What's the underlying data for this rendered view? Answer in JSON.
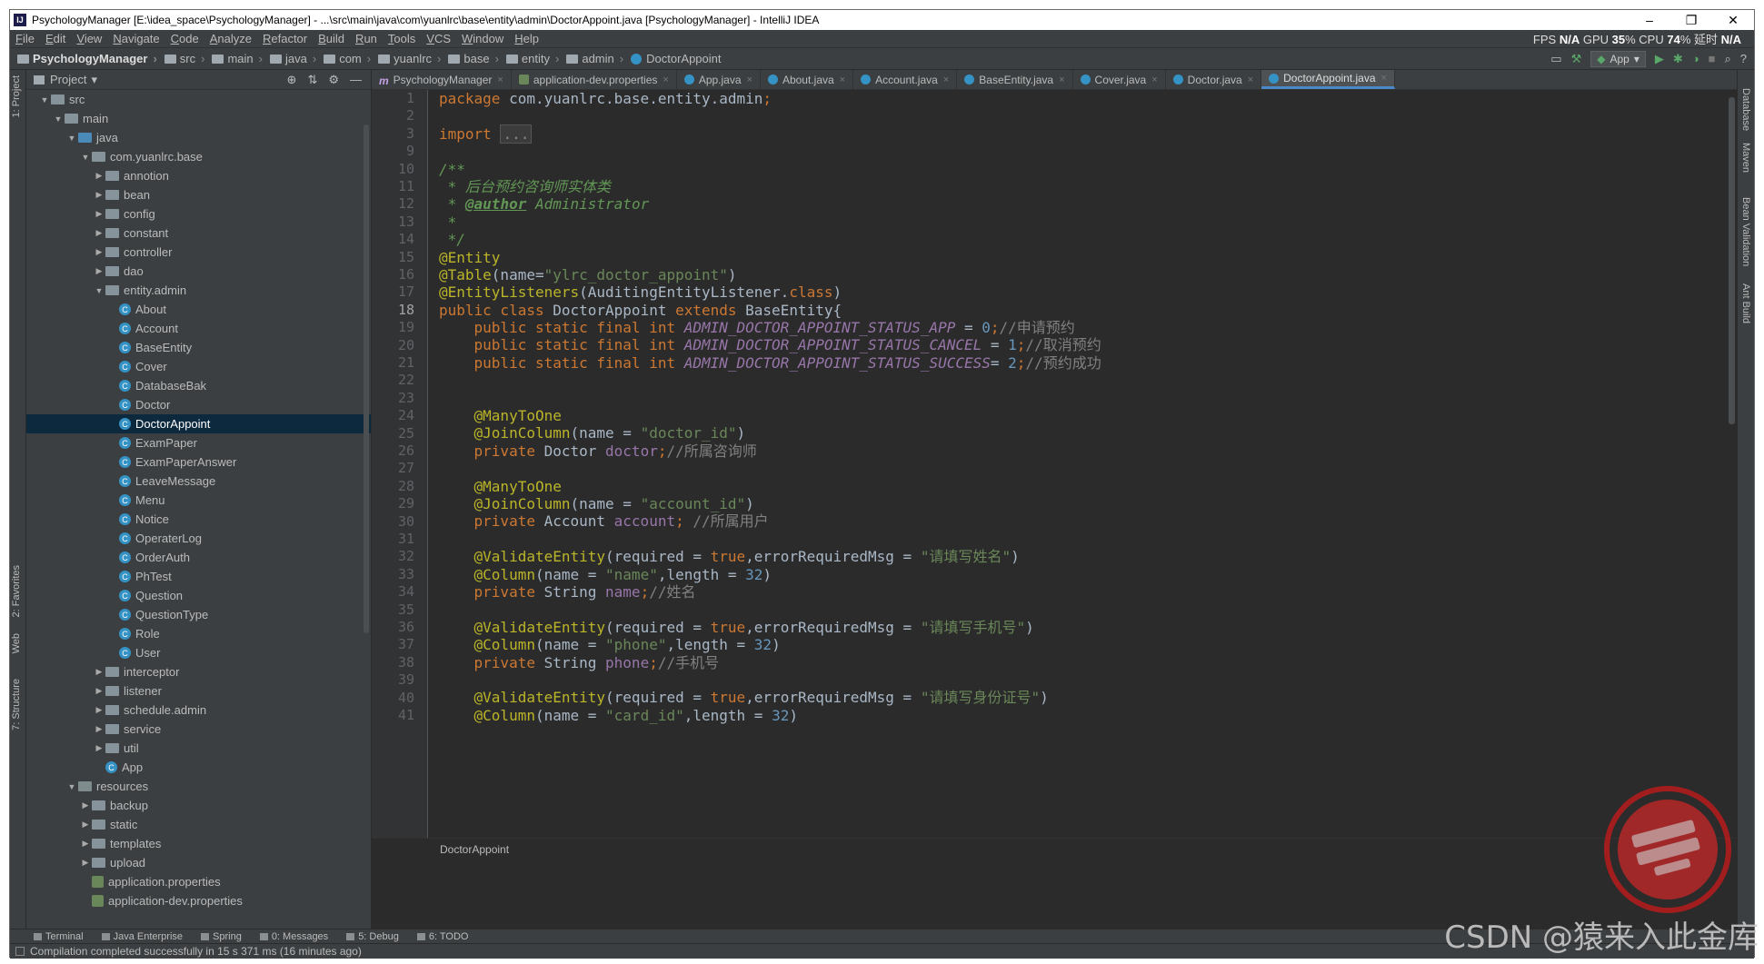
{
  "window": {
    "title": "PsychologyManager [E:\\idea_space\\PsychologyManager] - ...\\src\\main\\java\\com\\yuanlrc\\base\\entity\\admin\\DoctorAppoint.java [PsychologyManager] - IntelliJ IDEA",
    "app_icon": "IJ",
    "min": "–",
    "max": "❐",
    "close": "✕"
  },
  "menu": [
    "File",
    "Edit",
    "View",
    "Navigate",
    "Code",
    "Analyze",
    "Refactor",
    "Build",
    "Run",
    "Tools",
    "VCS",
    "Window",
    "Help"
  ],
  "perf": {
    "fps_label": "FPS",
    "fps": "N/A",
    "gpu_label": "GPU",
    "gpu": "35",
    "cpu_label": "% CPU",
    "cpu": "74",
    "delay_label": "% 延时",
    "delay": "N/A"
  },
  "breadcrumbs": [
    "PsychologyManager",
    "src",
    "main",
    "java",
    "com",
    "yuanlrc",
    "base",
    "entity",
    "admin",
    "DoctorAppoint"
  ],
  "run_config": "App",
  "project_panel": {
    "title": "Project",
    "tree": [
      {
        "label": "src",
        "depth": 1,
        "kind": "folder",
        "open": true
      },
      {
        "label": "main",
        "depth": 2,
        "kind": "folder",
        "open": true
      },
      {
        "label": "java",
        "depth": 3,
        "kind": "src",
        "open": true
      },
      {
        "label": "com.yuanlrc.base",
        "depth": 4,
        "kind": "folder",
        "open": true
      },
      {
        "label": "annotion",
        "depth": 5,
        "kind": "folder",
        "open": false
      },
      {
        "label": "bean",
        "depth": 5,
        "kind": "folder",
        "open": false
      },
      {
        "label": "config",
        "depth": 5,
        "kind": "folder",
        "open": false
      },
      {
        "label": "constant",
        "depth": 5,
        "kind": "folder",
        "open": false
      },
      {
        "label": "controller",
        "depth": 5,
        "kind": "folder",
        "open": false
      },
      {
        "label": "dao",
        "depth": 5,
        "kind": "folder",
        "open": false
      },
      {
        "label": "entity.admin",
        "depth": 5,
        "kind": "folder",
        "open": true
      },
      {
        "label": "About",
        "depth": 6,
        "kind": "class"
      },
      {
        "label": "Account",
        "depth": 6,
        "kind": "class"
      },
      {
        "label": "BaseEntity",
        "depth": 6,
        "kind": "class"
      },
      {
        "label": "Cover",
        "depth": 6,
        "kind": "class"
      },
      {
        "label": "DatabaseBak",
        "depth": 6,
        "kind": "class"
      },
      {
        "label": "Doctor",
        "depth": 6,
        "kind": "class"
      },
      {
        "label": "DoctorAppoint",
        "depth": 6,
        "kind": "class",
        "selected": true
      },
      {
        "label": "ExamPaper",
        "depth": 6,
        "kind": "class"
      },
      {
        "label": "ExamPaperAnswer",
        "depth": 6,
        "kind": "class"
      },
      {
        "label": "LeaveMessage",
        "depth": 6,
        "kind": "class"
      },
      {
        "label": "Menu",
        "depth": 6,
        "kind": "class"
      },
      {
        "label": "Notice",
        "depth": 6,
        "kind": "class"
      },
      {
        "label": "OperaterLog",
        "depth": 6,
        "kind": "class"
      },
      {
        "label": "OrderAuth",
        "depth": 6,
        "kind": "class"
      },
      {
        "label": "PhTest",
        "depth": 6,
        "kind": "class"
      },
      {
        "label": "Question",
        "depth": 6,
        "kind": "class"
      },
      {
        "label": "QuestionType",
        "depth": 6,
        "kind": "class"
      },
      {
        "label": "Role",
        "depth": 6,
        "kind": "class"
      },
      {
        "label": "User",
        "depth": 6,
        "kind": "class"
      },
      {
        "label": "interceptor",
        "depth": 5,
        "kind": "folder",
        "open": false
      },
      {
        "label": "listener",
        "depth": 5,
        "kind": "folder",
        "open": false
      },
      {
        "label": "schedule.admin",
        "depth": 5,
        "kind": "folder",
        "open": false
      },
      {
        "label": "service",
        "depth": 5,
        "kind": "folder",
        "open": false
      },
      {
        "label": "util",
        "depth": 5,
        "kind": "folder",
        "open": false
      },
      {
        "label": "App",
        "depth": 5,
        "kind": "class"
      },
      {
        "label": "resources",
        "depth": 3,
        "kind": "res",
        "open": true
      },
      {
        "label": "backup",
        "depth": 4,
        "kind": "folder",
        "open": false
      },
      {
        "label": "static",
        "depth": 4,
        "kind": "folder",
        "open": false
      },
      {
        "label": "templates",
        "depth": 4,
        "kind": "folder",
        "open": false
      },
      {
        "label": "upload",
        "depth": 4,
        "kind": "folder",
        "open": false
      },
      {
        "label": "application.properties",
        "depth": 4,
        "kind": "prop"
      },
      {
        "label": "application-dev.properties",
        "depth": 4,
        "kind": "prop"
      }
    ]
  },
  "tabs": [
    {
      "label": "PsychologyManager",
      "icon": "m"
    },
    {
      "label": "application-dev.properties",
      "icon": "p"
    },
    {
      "label": "App.java",
      "icon": "c"
    },
    {
      "label": "About.java",
      "icon": "c"
    },
    {
      "label": "Account.java",
      "icon": "c"
    },
    {
      "label": "BaseEntity.java",
      "icon": "c"
    },
    {
      "label": "Cover.java",
      "icon": "c"
    },
    {
      "label": "Doctor.java",
      "icon": "c"
    },
    {
      "label": "DoctorAppoint.java",
      "icon": "c",
      "active": true
    }
  ],
  "code": {
    "current_line": 18,
    "lines": [
      {
        "n": 1,
        "html": "<span class=\"kw\">package </span>com.yuanlrc.base.entity.admin<span class=\"kw\">;</span>"
      },
      {
        "n": 2,
        "html": ""
      },
      {
        "n": 3,
        "html": "<span class=\"kw\">import </span><span class=\"fold-box\">...</span>"
      },
      {
        "n": 9,
        "html": ""
      },
      {
        "n": 10,
        "html": "<span class=\"doc\">/**</span>"
      },
      {
        "n": 11,
        "html": "<span class=\"doc\"> * 后台预约咨询师实体类</span>"
      },
      {
        "n": 12,
        "html": "<span class=\"doc\"> * </span><span class=\"doctag\">@author</span><span class=\"doc\"> Administrator</span>"
      },
      {
        "n": 13,
        "html": "<span class=\"doc\"> *</span>"
      },
      {
        "n": 14,
        "html": "<span class=\"doc\"> */</span>"
      },
      {
        "n": 15,
        "html": "<span class=\"ann\">@Entity</span>"
      },
      {
        "n": 16,
        "html": "<span class=\"ann\">@Table</span>(name=<span class=\"str\">\"ylrc_doctor_appoint\"</span>)"
      },
      {
        "n": 17,
        "html": "<span class=\"ann\">@EntityListeners</span>(AuditingEntityListener.<span class=\"kw\">class</span>)"
      },
      {
        "n": 18,
        "html": "<span class=\"kw\">public class </span>DoctorAppoint <span class=\"kw\">extends </span>BaseEntity{"
      },
      {
        "n": 19,
        "html": "    <span class=\"kw\">public static final int </span><span class=\"sfld\">ADMIN_DOCTOR_APPOINT_STATUS_APP</span> = <span class=\"num\">0</span><span class=\"kw\">;</span><span class=\"cmt\">//申请预约</span>"
      },
      {
        "n": 20,
        "html": "    <span class=\"kw\">public static final int </span><span class=\"sfld\">ADMIN_DOCTOR_APPOINT_STATUS_CANCEL</span> = <span class=\"num\">1</span><span class=\"kw\">;</span><span class=\"cmt\">//取消预约</span>"
      },
      {
        "n": 21,
        "html": "    <span class=\"kw\">public static final int </span><span class=\"sfld\">ADMIN_DOCTOR_APPOINT_STATUS_SUCCESS</span>= <span class=\"num\">2</span><span class=\"kw\">;</span><span class=\"cmt\">//预约成功</span>"
      },
      {
        "n": 22,
        "html": ""
      },
      {
        "n": 23,
        "html": ""
      },
      {
        "n": 24,
        "html": "    <span class=\"ann\">@ManyToOne</span>"
      },
      {
        "n": 25,
        "html": "    <span class=\"ann\">@JoinColumn</span>(name = <span class=\"str\">\"doctor_id\"</span>)"
      },
      {
        "n": 26,
        "html": "    <span class=\"kw\">private </span>Doctor <span class=\"fld\">doctor</span><span class=\"kw\">;</span><span class=\"cmt\">//所属咨询师</span>"
      },
      {
        "n": 27,
        "html": ""
      },
      {
        "n": 28,
        "html": "    <span class=\"ann\">@ManyToOne</span>"
      },
      {
        "n": 29,
        "html": "    <span class=\"ann\">@JoinColumn</span>(name = <span class=\"str\">\"account_id\"</span>)"
      },
      {
        "n": 30,
        "html": "    <span class=\"kw\">private </span>Account <span class=\"fld\">account</span><span class=\"kw\">; </span><span class=\"cmt\">//所属用户</span>"
      },
      {
        "n": 31,
        "html": ""
      },
      {
        "n": 32,
        "html": "    <span class=\"ann\">@ValidateEntity</span>(required = <span class=\"kw\">true</span>,errorRequiredMsg = <span class=\"str\">\"请填写姓名\"</span>)"
      },
      {
        "n": 33,
        "html": "    <span class=\"ann\">@Column</span>(name = <span class=\"str\">\"name\"</span>,length = <span class=\"num\">32</span>)"
      },
      {
        "n": 34,
        "html": "    <span class=\"kw\">private </span>String <span class=\"fld\">name</span><span class=\"kw\">;</span><span class=\"cmt\">//姓名</span>"
      },
      {
        "n": 35,
        "html": ""
      },
      {
        "n": 36,
        "html": "    <span class=\"ann\">@ValidateEntity</span>(required = <span class=\"kw\">true</span>,errorRequiredMsg = <span class=\"str\">\"请填写手机号\"</span>)"
      },
      {
        "n": 37,
        "html": "    <span class=\"ann\">@Column</span>(name = <span class=\"str\">\"phone\"</span>,length = <span class=\"num\">32</span>)"
      },
      {
        "n": 38,
        "html": "    <span class=\"kw\">private </span>String <span class=\"fld\">phone</span><span class=\"kw\">;</span><span class=\"cmt\">//手机号</span>"
      },
      {
        "n": 39,
        "html": ""
      },
      {
        "n": 40,
        "html": "    <span class=\"ann\">@ValidateEntity</span>(required = <span class=\"kw\">true</span>,errorRequiredMsg = <span class=\"str\">\"请填写身份证号\"</span>)"
      },
      {
        "n": 41,
        "html": "    <span class=\"ann\">@Column</span>(name = <span class=\"str\">\"card_id\"</span>,length = <span class=\"num\">32</span>)"
      }
    ]
  },
  "editor_breadcrumb": "DoctorAppoint",
  "right_stripe": [
    "Database",
    "Maven",
    "Bean Validation",
    "Ant Build"
  ],
  "left_stripe": [
    "1: Project",
    "2: Favorites",
    "Web",
    "7: Structure"
  ],
  "bottom_tools": [
    "Terminal",
    "Java Enterprise",
    "Spring",
    "0: Messages",
    "5: Debug",
    "6: TODO"
  ],
  "status": "Compilation completed successfully in 15 s 371 ms (16 minutes ago)",
  "watermark": "CSDN @猿来入此金库",
  "colors": {
    "accent": "#4a88c7",
    "selection": "#0d293e",
    "editor_bg": "#2b2b2b",
    "panel_bg": "#3c3f41"
  }
}
